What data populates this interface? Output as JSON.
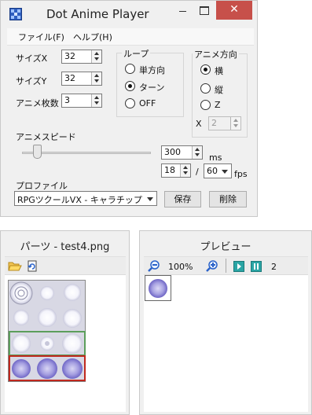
{
  "window": {
    "title": "Dot Anime Player",
    "close_glyph": "✕"
  },
  "menu": {
    "file": "ファイル(F)",
    "help": "ヘルプ(H)"
  },
  "size_x": {
    "label": "サイズX",
    "value": "32"
  },
  "size_y": {
    "label": "サイズY",
    "value": "32"
  },
  "frame_count": {
    "label": "アニメ枚数",
    "value": "3"
  },
  "loop_group": {
    "title": "ループ",
    "options": [
      "単方向",
      "ターン",
      "OFF"
    ],
    "selected": "ターン"
  },
  "direction_group": {
    "title": "アニメ方向",
    "options": [
      "横",
      "縦",
      "Z"
    ],
    "selected": "横",
    "x_label": "X",
    "x_value": "2"
  },
  "speed": {
    "label": "アニメスピード",
    "ms_value": "300",
    "ms_unit": "ms",
    "frames_value": "18",
    "divider": "/",
    "fps_value": "60",
    "fps_unit": "fps",
    "slider_fraction": 0.1
  },
  "profile": {
    "label": "プロファイル",
    "selected": "RPGツクールVX - キャラチップ",
    "save_label": "保存",
    "delete_label": "削除"
  },
  "parts_panel": {
    "title": "パーツ - test4.png",
    "icons": [
      "open-folder-icon",
      "reload-icon"
    ]
  },
  "preview_panel": {
    "title": "プレビュー",
    "zoom": "100%",
    "current_frame": "2",
    "icons": [
      "zoom-out-icon",
      "zoom-in-icon",
      "play-icon",
      "pause-icon"
    ]
  },
  "colors": {
    "close_button": "#c7504a",
    "selection_green": "#5c9e5c",
    "selection_red": "#c0281e",
    "playback_teal": "#2aa5a5"
  }
}
